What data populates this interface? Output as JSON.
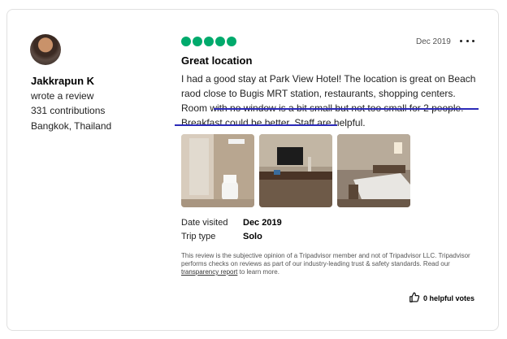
{
  "review": {
    "user": {
      "name": "Jakkrapun K",
      "action": "wrote a review",
      "contributions": "331 contributions",
      "location": "Bangkok, Thailand"
    },
    "rating": 5,
    "rating_max": 5,
    "date": "Dec 2019",
    "title": "Great location",
    "text_part1": "I had a good stay at Park View Hotel! The location is great on Beach raod close to Bugis MRT station, restaurants, shopping centers. Room with no window is a bit small but not too small for 2 people. Breakfast could be better. Staff are helpful.",
    "photos": [
      "bathroom-photo",
      "room-tv-photo",
      "bedroom-photo"
    ],
    "date_visited_label": "Date visited",
    "date_visited_value": "Dec 2019",
    "trip_type_label": "Trip type",
    "trip_type_value": "Solo",
    "disclaimer_before": "This review is the subjective opinion of a Tripadvisor member and not of Tripadvisor LLC. Tripadvisor performs checks on reviews as part of our industry-leading trust & safety standards. Read our ",
    "disclaimer_link": "transparency report",
    "disclaimer_after": " to learn more.",
    "helpful_votes": "0 helpful votes"
  },
  "colors": {
    "bubble": "#00aa6c",
    "annotation": "#2b2ab8"
  },
  "icons": [
    "more-options-icon",
    "thumbs-up-icon"
  ]
}
